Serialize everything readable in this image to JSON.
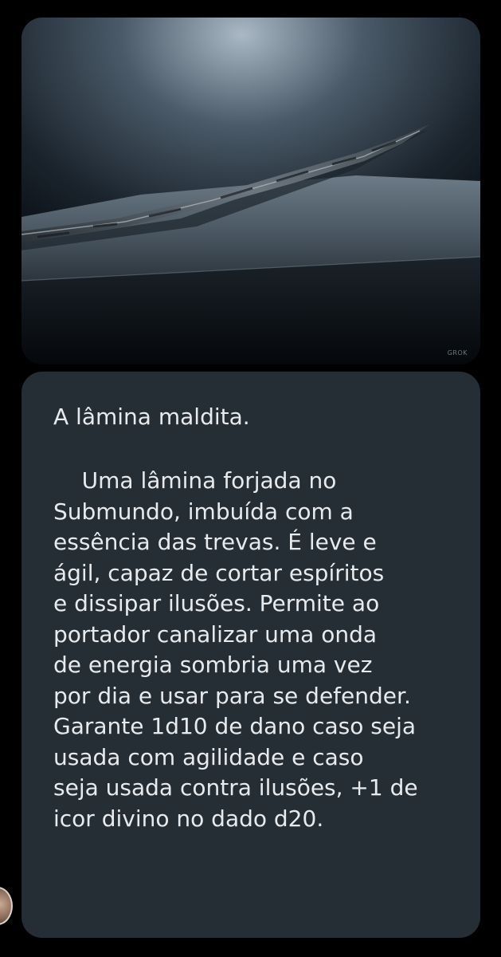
{
  "image": {
    "description_icon": "cursed-blade-image",
    "watermark": "GROK"
  },
  "card": {
    "title": "A lâmina maldita.",
    "body": "    Uma lâmina forjada no\nSubmundo, imbuída com a\nessência das trevas. É leve e\nágil, capaz de cortar espíritos\ne dissipar ilusões. Permite ao\nportador canalizar uma onda\nde energia sombria uma vez\npor dia e usar para se defender.\nGarante 1d10 de dano caso seja\nusada com agilidade e caso\nseja usada contra ilusões, +1 de\nicor divino no dado d20."
  },
  "colors": {
    "background": "#000000",
    "card_background": "#252e35",
    "text": "#e8ebee"
  }
}
